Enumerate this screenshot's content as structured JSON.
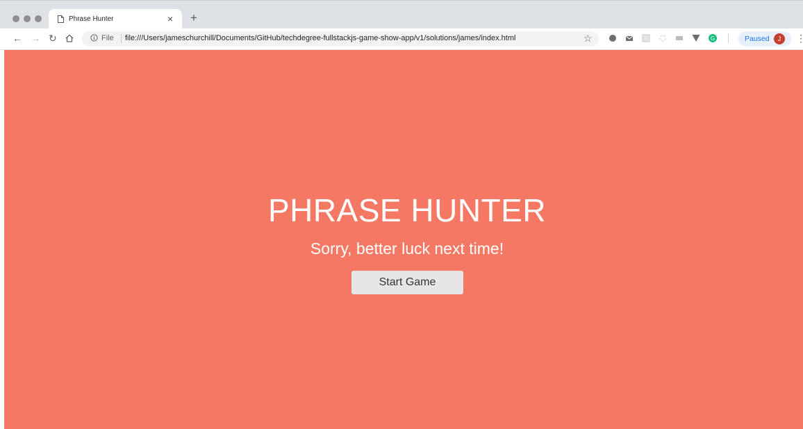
{
  "browser": {
    "tab_title": "Phrase Hunter",
    "close_glyph": "×",
    "new_tab_glyph": "+",
    "address": {
      "scheme_label": "File",
      "url": "file:///Users/jameschurchill/Documents/GitHub/techdegree-fullstackjs-game-show-app/v1/solutions/james/index.html"
    },
    "profile": {
      "status": "Paused",
      "initial": "J"
    }
  },
  "page": {
    "background": "#f47863",
    "title": "PHRASE HUNTER",
    "message": "Sorry, better luck next time!",
    "start_button_label": "Start Game"
  }
}
